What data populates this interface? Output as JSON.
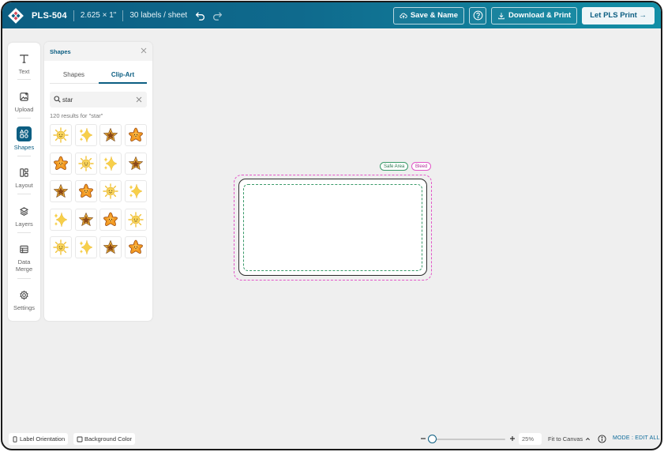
{
  "colors": {
    "brand": "#0c5e82",
    "bleed": "#e256c8",
    "safe": "#3a9a6a"
  },
  "header": {
    "logo_icon": "pls-logo-icon",
    "product_code": "PLS-504",
    "label_size": "2.625 × 1\"",
    "labels_per_sheet": "30 labels / sheet",
    "undo_icon": "undo-icon",
    "redo_icon": "redo-icon",
    "save_label": "Save & Name",
    "help_icon": "help-icon",
    "download_label": "Download & Print",
    "print_label": "Let PLS Print →"
  },
  "toolbar": {
    "items": [
      {
        "label": "Text",
        "icon": "text-icon"
      },
      {
        "label": "Upload",
        "icon": "upload-icon"
      },
      {
        "label": "Shapes",
        "icon": "shapes-icon",
        "active": true
      },
      {
        "label": "Layout",
        "icon": "layout-icon"
      },
      {
        "label": "Layers",
        "icon": "layers-icon"
      },
      {
        "label": "Data Merge",
        "icon": "data-merge-icon"
      },
      {
        "label": "Settings",
        "icon": "settings-icon"
      }
    ]
  },
  "panel": {
    "title": "Shapes",
    "tabs": [
      {
        "label": "Shapes"
      },
      {
        "label": "Clip-Art",
        "selected": true
      }
    ],
    "search": {
      "value": "star",
      "placeholder": ""
    },
    "results_text": "120 results for \"star\"",
    "clipart": [
      "sun-icon",
      "sparkles-icon",
      "brown-star-icon",
      "orange-star-icon",
      "orange-star-icon",
      "sun-icon",
      "sparkles-icon",
      "brown-star-icon",
      "brown-star-icon",
      "orange-star-icon",
      "sun-icon",
      "sparkles-icon",
      "sparkles-icon",
      "brown-star-icon",
      "orange-star-icon",
      "sun-icon",
      "sun-icon",
      "sparkles-icon",
      "brown-star-icon",
      "orange-star-icon"
    ]
  },
  "canvas": {
    "safe_area_label": "Safe Area",
    "bleed_label": "Bleed"
  },
  "bottom": {
    "orientation_label": "Label Orientation",
    "background_label": "Background Color",
    "zoom": "25%",
    "zoom_fraction": 0.0,
    "fit_label": "Fit to Canvas",
    "mode_label": "MODE : EDIT ALL"
  }
}
